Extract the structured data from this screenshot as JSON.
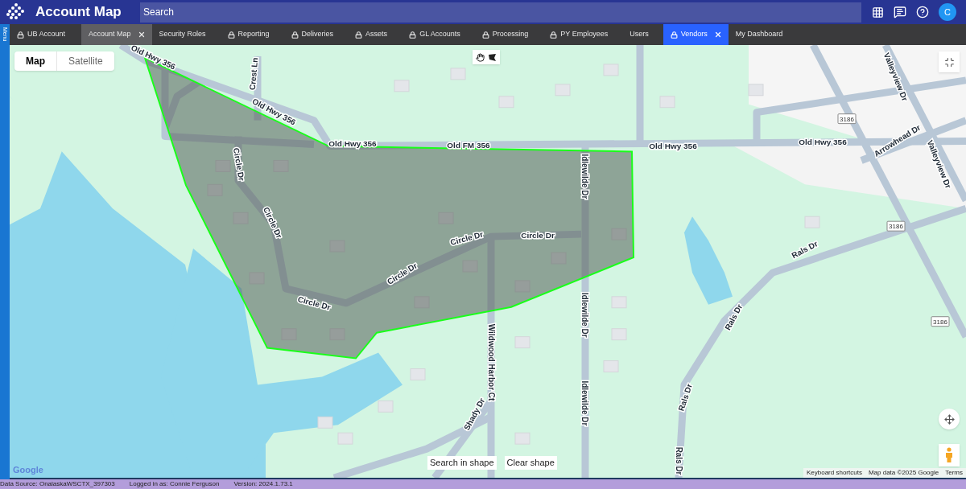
{
  "header": {
    "title": "Account Map",
    "search": {
      "placeholder": "Search"
    },
    "avatar": "C"
  },
  "side_menu": {
    "label": "Menu"
  },
  "tabs": [
    {
      "label": "UB Account",
      "locked": true,
      "closable": false,
      "hovered": false,
      "selected": false
    },
    {
      "label": "Account Map",
      "locked": false,
      "closable": true,
      "hovered": true,
      "selected": false
    },
    {
      "label": "Security Roles",
      "locked": false,
      "closable": false,
      "hovered": false,
      "selected": false
    },
    {
      "label": "Reporting",
      "locked": true,
      "closable": false,
      "hovered": false,
      "selected": false
    },
    {
      "label": "Deliveries",
      "locked": true,
      "closable": false,
      "hovered": false,
      "selected": false
    },
    {
      "label": "Assets",
      "locked": true,
      "closable": false,
      "hovered": false,
      "selected": false
    },
    {
      "label": "GL Accounts",
      "locked": true,
      "closable": false,
      "hovered": false,
      "selected": false
    },
    {
      "label": "Processing",
      "locked": true,
      "closable": false,
      "hovered": false,
      "selected": false
    },
    {
      "label": "PY Employees",
      "locked": true,
      "closable": false,
      "hovered": false,
      "selected": false
    },
    {
      "label": "Users",
      "locked": false,
      "closable": false,
      "hovered": false,
      "selected": false
    },
    {
      "label": "Vendors",
      "locked": true,
      "closable": true,
      "hovered": false,
      "selected": true
    },
    {
      "label": "My Dashboard",
      "locked": false,
      "closable": false,
      "hovered": false,
      "selected": false
    }
  ],
  "map": {
    "map_types": [
      {
        "label": "Map",
        "selected": true
      },
      {
        "label": "Satellite",
        "selected": false
      }
    ],
    "road_labels": [
      "Old Hwy 356",
      "Old Hwy 356",
      "Old Hwy 356",
      "Old FM 356",
      "Old Hwy 356",
      "Old Hwy 356",
      "Crest Ln",
      "Circle Dr",
      "Circle Dr",
      "Circle Dr",
      "Circle Dr",
      "Circle Dr",
      "Circle Dr",
      "Idlewilde Dr",
      "Idlewilde Dr",
      "Idlewilde Dr",
      "Wildwood Harbor Ct",
      "Shady Dr",
      "Rals Dr",
      "Rals Dr",
      "Rals Dr",
      "Rals Dr",
      "Arrowhead Dr",
      "Valleyview Dr",
      "Valleyview Dr"
    ],
    "route_shields": [
      "3186",
      "3186",
      "3186"
    ],
    "shape_buttons": [
      "Search in shape",
      "Clear shape"
    ],
    "logo": "Google",
    "attribution": [
      "Keyboard shortcuts",
      "Map data ©2025 Google",
      "Terms"
    ]
  },
  "status_bar": [
    "Data Source: OnalaskaWSCTX_397303",
    "Logged in as: Connie Ferguson",
    "Version: 2024.1.73.1"
  ]
}
